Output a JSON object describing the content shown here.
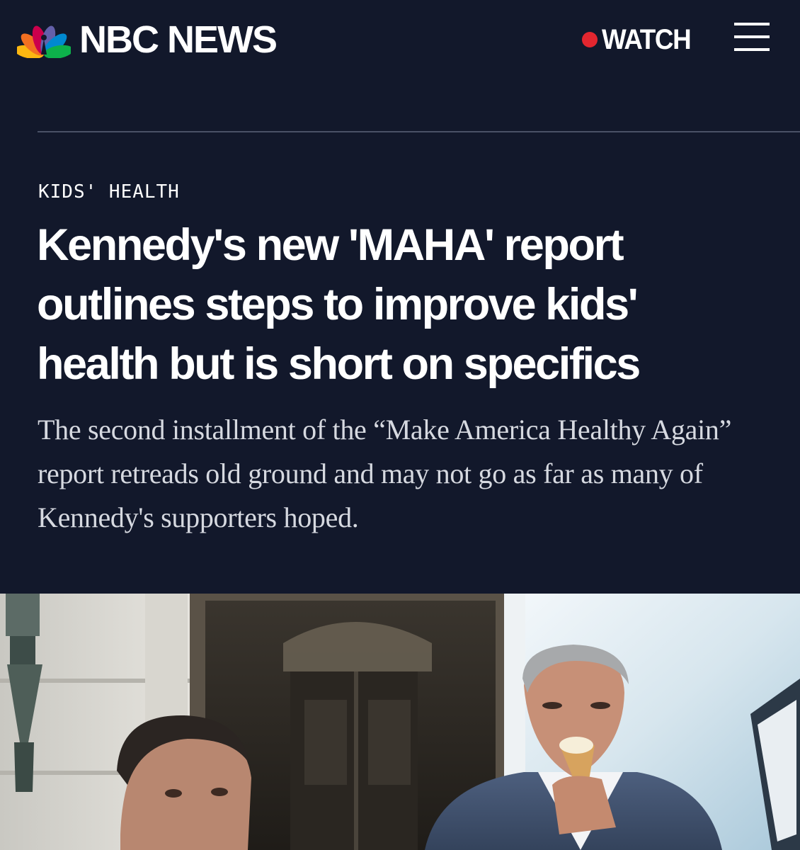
{
  "header": {
    "brand": "NBC NEWS",
    "watch_label": "WATCH",
    "icons": {
      "logo": "nbc-peacock-icon",
      "live": "live-dot-icon",
      "menu": "hamburger-menu-icon"
    },
    "colors": {
      "background": "#12182b",
      "live_dot": "#e3262f",
      "text": "#ffffff"
    }
  },
  "article": {
    "section": "KIDS' HEALTH",
    "headline": "Kennedy's new 'MAHA' report outlines steps to improve kids' health but is short on specifics",
    "dek": "The second installment of the “Make America Healthy Again” report retreads old ground and may not go as far as many of Kennedy's supporters hoped."
  }
}
